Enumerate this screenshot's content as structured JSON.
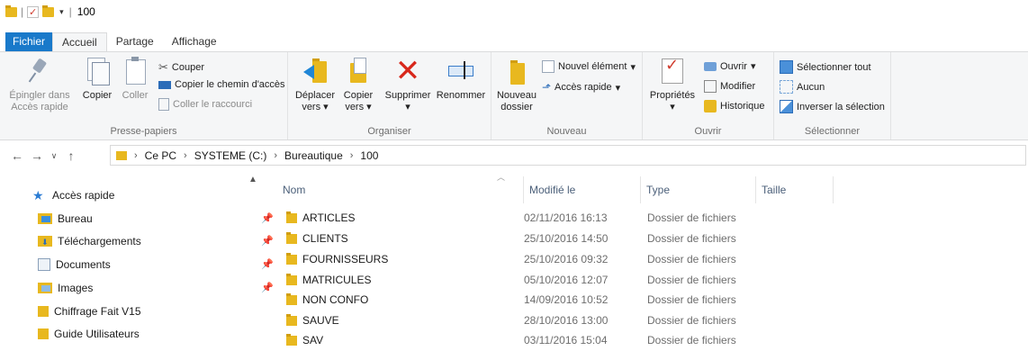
{
  "titlebar": {
    "path": "100"
  },
  "tabs": [
    "Fichier",
    "Accueil",
    "Partage",
    "Affichage"
  ],
  "ribbon": {
    "clipboard": {
      "pin_label_1": "Épingler dans",
      "pin_label_2": "Accès rapide",
      "copy": "Copier",
      "paste": "Coller",
      "cut": "Couper",
      "copy_path": "Copier le chemin d'accès",
      "paste_shortcut": "Coller le raccourci",
      "group": "Presse-papiers"
    },
    "organize": {
      "move_1": "Déplacer",
      "move_2": "vers",
      "copy_1": "Copier",
      "copy_2": "vers",
      "delete": "Supprimer",
      "rename": "Renommer",
      "group": "Organiser"
    },
    "new": {
      "new_folder_1": "Nouveau",
      "new_folder_2": "dossier",
      "new_item": "Nouvel élément",
      "easy_access": "Accès rapide",
      "group": "Nouveau"
    },
    "open": {
      "properties": "Propriétés",
      "open": "Ouvrir",
      "edit": "Modifier",
      "history": "Historique",
      "group": "Ouvrir"
    },
    "select": {
      "select_all": "Sélectionner tout",
      "select_none": "Aucun",
      "invert": "Inverser la sélection",
      "group": "Sélectionner"
    }
  },
  "address": {
    "crumbs": [
      "Ce PC",
      "SYSTEME (C:)",
      "Bureautique",
      "100"
    ]
  },
  "nav": {
    "items": [
      {
        "label": "Accès rapide"
      },
      {
        "label": "Bureau"
      },
      {
        "label": "Téléchargements"
      },
      {
        "label": "Documents"
      },
      {
        "label": "Images"
      },
      {
        "label": "Chiffrage Fait V15"
      },
      {
        "label": "Guide Utilisateurs"
      }
    ]
  },
  "columns": {
    "name": "Nom",
    "modified": "Modifié le",
    "type": "Type",
    "size": "Taille"
  },
  "files": [
    {
      "name": "ARTICLES",
      "date": "02/11/2016 16:13",
      "type": "Dossier de fichiers"
    },
    {
      "name": "CLIENTS",
      "date": "25/10/2016 14:50",
      "type": "Dossier de fichiers"
    },
    {
      "name": "FOURNISSEURS",
      "date": "25/10/2016 09:32",
      "type": "Dossier de fichiers"
    },
    {
      "name": "MATRICULES",
      "date": "05/10/2016 12:07",
      "type": "Dossier de fichiers"
    },
    {
      "name": "NON CONFO",
      "date": "14/09/2016 10:52",
      "type": "Dossier de fichiers"
    },
    {
      "name": "SAUVE",
      "date": "28/10/2016 13:00",
      "type": "Dossier de fichiers"
    },
    {
      "name": "SAV",
      "date": "03/11/2016 15:04",
      "type": "Dossier de fichiers"
    }
  ],
  "colors": {
    "file_tab": "#1979ca",
    "folder": "#e8b81f",
    "delete": "#d8281c",
    "accent_blue": "#1f86d6"
  }
}
